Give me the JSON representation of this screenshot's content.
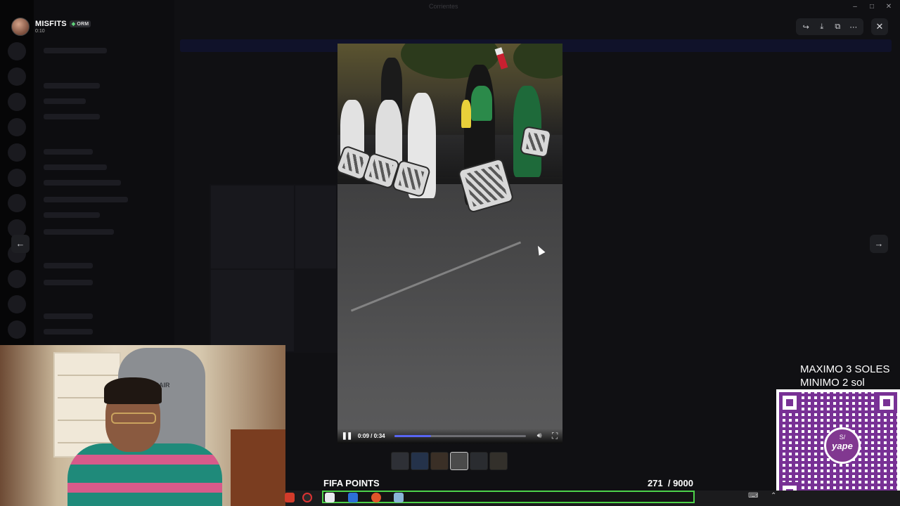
{
  "window": {
    "title": "Corrientes"
  },
  "user": {
    "name": "MISFITS",
    "tag": "ORM",
    "timestamp": "0:10"
  },
  "toolbar": {
    "forward_icon": "forward-icon",
    "download_icon": "download-icon",
    "open_external_icon": "open-external-icon",
    "more_icon": "more-icon",
    "close_icon": "close-icon"
  },
  "navigation": {
    "prev_icon": "arrow-left-icon",
    "next_icon": "arrow-right-icon"
  },
  "video": {
    "current_time": "0:09 / 0:34",
    "progress": 0.28,
    "play_state": "playing"
  },
  "thumbnails": {
    "count": 6,
    "selected_index": 3
  },
  "donation": {
    "max_text": "MAXIMO 3 SOLES",
    "min_text": "MINIMO 2 sol",
    "qr_logo_currency": "S/",
    "qr_logo_brand": "yape"
  },
  "fifa": {
    "label": "FIFA POINTS",
    "count": "271  / 9000"
  },
  "colors": {
    "accent": "#5865f2",
    "fifa_border": "#4dd34a",
    "qr": "#6a1b8a"
  }
}
